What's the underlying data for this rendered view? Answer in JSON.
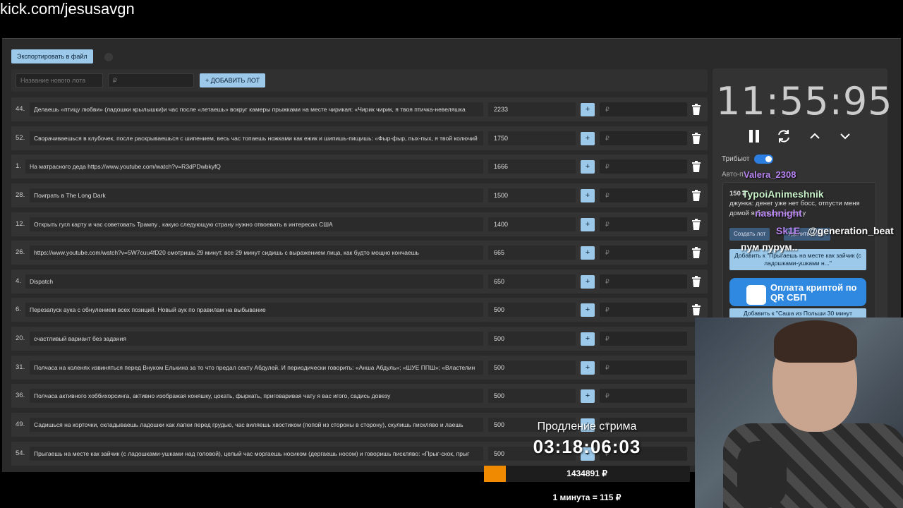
{
  "url": "kick.com/jesusavgn",
  "export_label": "Экспортировать в файл",
  "new_lot": {
    "name_placeholder": "Название нового лота",
    "amount_placeholder": "₽",
    "add_label": "+ ДОБАВИТЬ ЛОТ"
  },
  "lots": [
    {
      "num": "44.",
      "name": "Делаешь «птицу любви» (ладошки крылышки)и час после «летаешь» вокруг камеры прыжками на месте чирикая: «Чирик чирик, я твоя птичка-невеляшка",
      "amount": "2233",
      "plus": "+",
      "rub": "₽"
    },
    {
      "num": "52.",
      "name": "Сворачиваешься в клубочек, после раскрываешься с шипением, весь час топаешь ножками как ежик и шипишь-пищишь: «Фыр-фыр, пых-пых, я твой колючий",
      "amount": "1750",
      "plus": "+",
      "rub": "₽"
    },
    {
      "num": "1.",
      "name": "На матрасного деда https://www.youtube.com/watch?v=R3dPDwbkyfQ",
      "amount": "1666",
      "plus": "+",
      "rub": "₽"
    },
    {
      "num": "28.",
      "name": "Поиграть в The Long Dark",
      "amount": "1500",
      "plus": "+",
      "rub": "₽"
    },
    {
      "num": "12.",
      "name": "Открыть гугл карту и час советовать Трампу , какую следующую страну нужно отвоевать в интересах США",
      "amount": "1400",
      "plus": "+",
      "rub": "₽"
    },
    {
      "num": "26.",
      "name": "https://www.youtube.com/watch?v=5W7cuu4fD20 смотришь 29 минут. все 29 минут сидишь с выражением лица, как будто мощно кончаешь",
      "amount": "665",
      "plus": "+",
      "rub": "₽"
    },
    {
      "num": "4.",
      "name": "Dispatch",
      "amount": "650",
      "plus": "+",
      "rub": "₽"
    },
    {
      "num": "6.",
      "name": "Перезапуск аука с обнулением всех позиций. Новый аук по правилам на выбывание",
      "amount": "500",
      "plus": "+",
      "rub": "₽"
    },
    {
      "num": "20.",
      "name": "счастливый вариант без задания",
      "amount": "500",
      "plus": "+",
      "rub": "₽"
    },
    {
      "num": "31.",
      "name": "Полчаса на коленях извиняться перед Внуком Елькина за то что предал секту Абдулей. И периодически говорить: «Анша Абдуль»; «ШУЕ ППШ»; «Властелин",
      "amount": "500",
      "plus": "+",
      "rub": "₽"
    },
    {
      "num": "36.",
      "name": "Полчаса активного хоббихорсинга, активно изображая коняшку, цокать, фыркать, приговаривая чату я вас игого, садись довезу",
      "amount": "500",
      "plus": "+",
      "rub": "₽"
    },
    {
      "num": "49.",
      "name": "Садишься на корточки, складываешь ладошки как лапки перед грудью, час виляешь хвостиком (попой из стороны в сторону), скулишь писклявo и лаешь",
      "amount": "500",
      "plus": "+",
      "rub": "₽"
    },
    {
      "num": "54.",
      "name": "Прыгаешь на месте как зайчик (с ладошками-ушками над головой), целый час моргаешь носиком (дергаешь носом) и говоришь писклявo: «Прыг-скок, прыг",
      "amount": "500",
      "plus": "+",
      "rub": "₽"
    }
  ],
  "sidebar": {
    "timer": "11:55:95",
    "tribute_label": "Трибьют",
    "auto_label": "Авто-п...",
    "donation_amount": "150 ₽",
    "donation_text": "джунка: денег уже нет босс, отпусти меня домой я больше не могу",
    "create_label": "Создать лот",
    "delete_label": "Удалить донат",
    "hint1": "Добавить к \"Прыгаешь на месте как зайчик (с ладошками-ушками н...\"",
    "hint2": "Добавить к \"Саша из Польши 30 минут",
    "crypto_label": "Оплата криптой по QR СБП"
  },
  "chat": {
    "u1": "Valera_2308",
    "u2": "TypoiAnimeshnik",
    "u3": "nashnight",
    "u4": "Sk1E",
    "msg4": "@generation_beat",
    "msg5": "пум пурум.."
  },
  "extension": {
    "title": "Продление стрима",
    "time": "03:18:06:03",
    "total": "1434891 ₽",
    "progress": 0.105,
    "rate": "1 минута = 115 ₽"
  },
  "colors": {
    "accent": "#9cc9ea",
    "progress": "#f08a00",
    "toggle": "#2c7ee0"
  }
}
